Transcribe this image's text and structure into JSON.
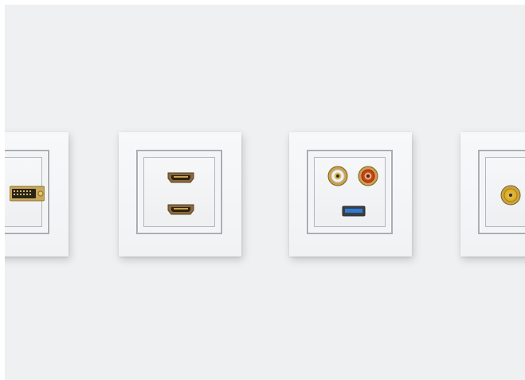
{
  "scene": {
    "background_color": "#eef0f2",
    "plates": [
      {
        "name": "dvi-plate",
        "ports": [
          "dvi-connector"
        ]
      },
      {
        "name": "hdmi-plate",
        "ports": [
          "hdmi-port",
          "hdmi-port"
        ]
      },
      {
        "name": "rca-usb-plate",
        "ports": [
          "rca-white-jack",
          "rca-red-jack",
          "usb-3-port"
        ]
      },
      {
        "name": "rca-yellow-plate",
        "ports": [
          "rca-yellow-jack"
        ]
      }
    ],
    "colors": {
      "plate": "#f4f5f7",
      "frame_border": "#a9adb2",
      "gold": "#c9a24a",
      "rca_red": "#d23a2a",
      "rca_white": "#f2f2f2",
      "rca_yellow": "#e0b21e",
      "usb_blue": "#2e7bd6"
    }
  }
}
